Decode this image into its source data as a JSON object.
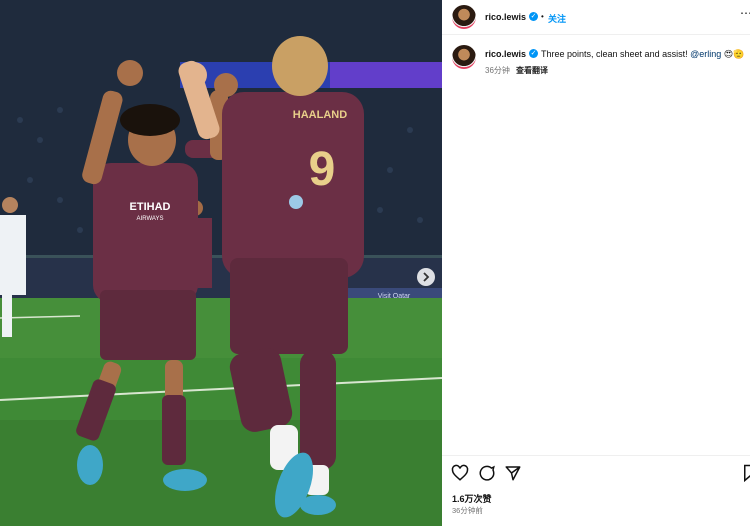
{
  "header": {
    "username": "rico.lewis",
    "dot": "•",
    "follow_label": "关注",
    "more_icon": "more-icon"
  },
  "caption": {
    "username": "rico.lewis",
    "text": "Three points, clean sheet and assist!",
    "mention": "@erling",
    "emojis": "😍🫡",
    "time": "36分钟",
    "translate_label": "查看翻译"
  },
  "photo": {
    "jersey_name": "HAALAND",
    "jersey_number": "9",
    "sponsor_top": "ETIHAD",
    "sponsor_bottom": "AIRWAYS",
    "board_ad": "Visit Qatar"
  },
  "actions": {
    "like_icon": "heart-icon",
    "comment_icon": "comment-icon",
    "share_icon": "share-icon",
    "save_icon": "bookmark-icon"
  },
  "stats": {
    "likes": "1.6万次赞",
    "time": "36分钟前"
  },
  "colors": {
    "accent": "#0095f6",
    "jersey": "#6b2f45"
  }
}
